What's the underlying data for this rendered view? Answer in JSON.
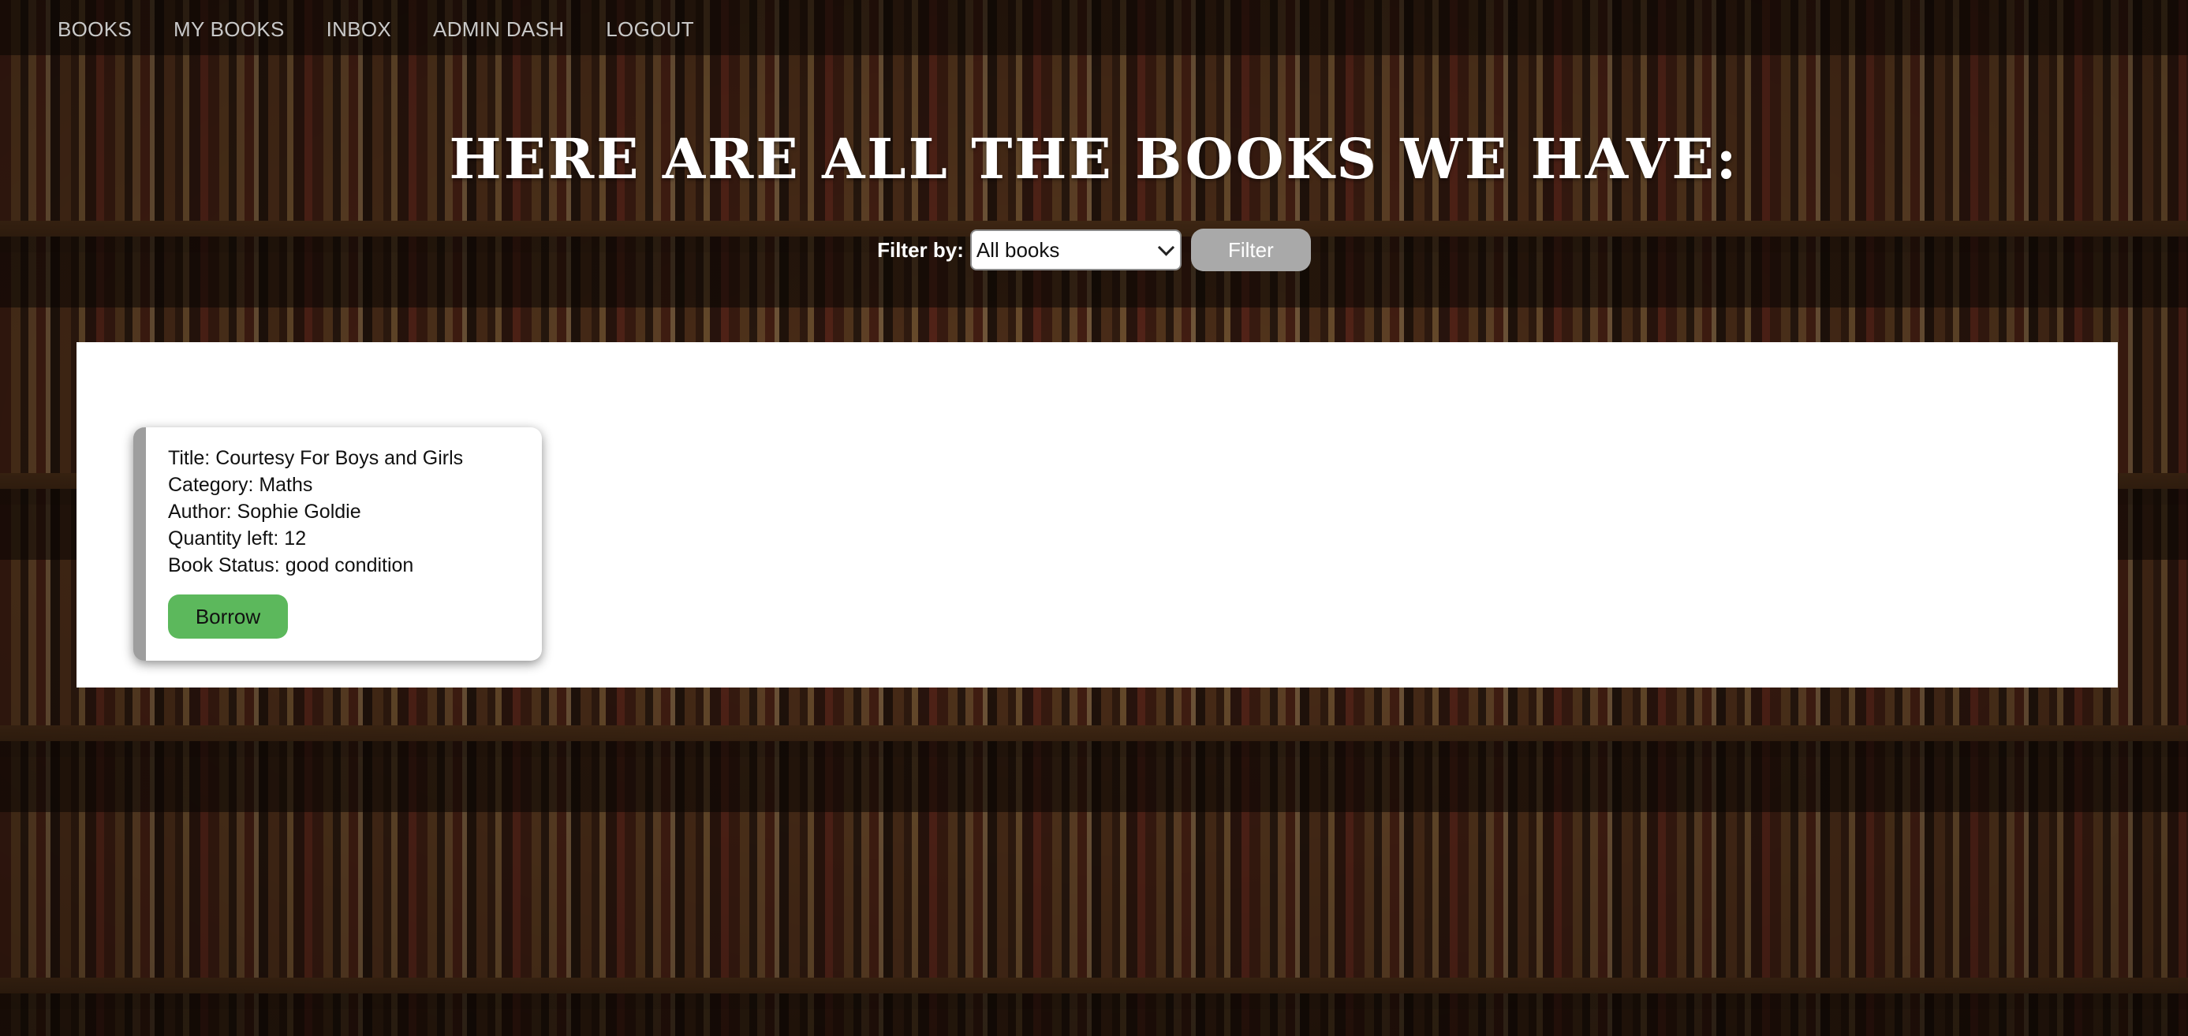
{
  "nav": {
    "items": [
      "BOOKS",
      "MY BOOKS",
      "INBOX",
      "ADMIN DASH",
      "LOGOUT"
    ]
  },
  "page": {
    "title": "HERE ARE ALL THE BOOKS WE HAVE:"
  },
  "filter": {
    "label": "Filter by:",
    "selected": "All books",
    "button_label": "Filter"
  },
  "books": [
    {
      "title_line": "Title: Courtesy For Boys and Girls",
      "category_line": "Category: Maths",
      "author_line": "Author: Sophie Goldie",
      "quantity_line": "Quantity left: 12",
      "status_line": "Book Status: good condition",
      "borrow_label": "Borrow"
    }
  ],
  "colors": {
    "borrow_button": "#5cb85c",
    "filter_button": "#a9a9a9",
    "panel": "#ffffff"
  }
}
